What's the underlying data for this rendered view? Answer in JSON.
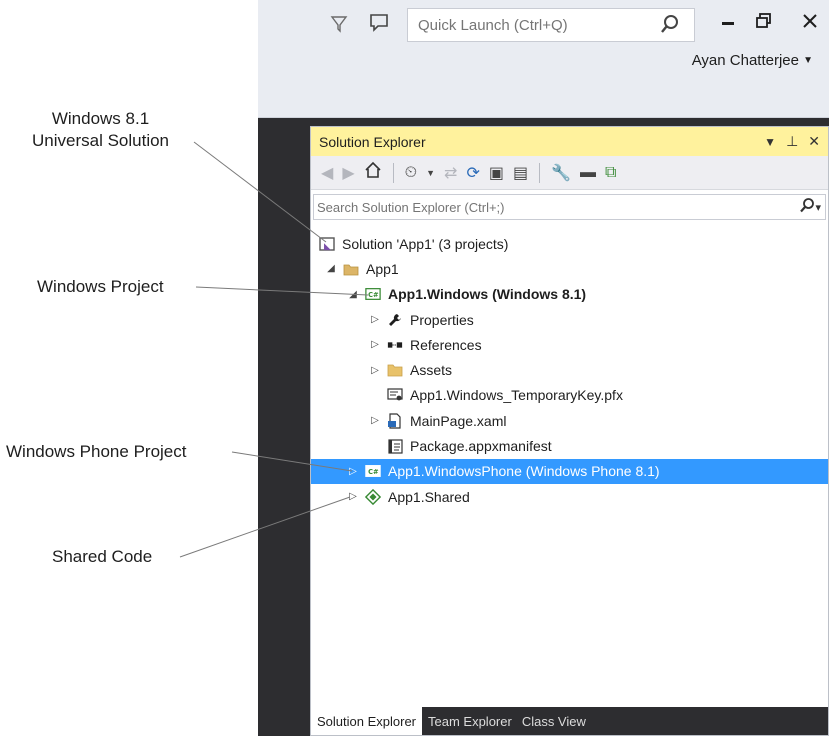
{
  "annotations": {
    "solution_line1": "Windows 8.1",
    "solution_line2": "Universal Solution",
    "windows_project": "Windows Project",
    "windows_phone_project": "Windows Phone Project",
    "shared_code": "Shared Code"
  },
  "titlebar": {
    "quick_launch_placeholder": "Quick Launch (Ctrl+Q)",
    "user_name": "Ayan Chatterjee",
    "icons": [
      "filter-icon",
      "feedback-icon",
      "search-icon",
      "minimize-icon",
      "restore-icon",
      "close-icon"
    ]
  },
  "solution_explorer": {
    "title": "Solution Explorer",
    "search_placeholder": "Search Solution Explorer (Ctrl+;)",
    "tree": {
      "solution": "Solution 'App1' (3 projects)",
      "app1": "App1",
      "app1_windows": "App1.Windows (Windows 8.1)",
      "properties": "Properties",
      "references": "References",
      "assets": "Assets",
      "temp_key": "App1.Windows_TemporaryKey.pfx",
      "mainpage": "MainPage.xaml",
      "package": "Package.appxmanifest",
      "app1_windowsphone": "App1.WindowsPhone (Windows Phone 8.1)",
      "app1_shared": "App1.Shared"
    },
    "bottom_tabs": [
      "Solution Explorer",
      "Team Explorer",
      "Class View"
    ]
  },
  "colors": {
    "title_highlight": "#fff29d",
    "selection": "#3399ff",
    "ide_dark": "#2d2d30",
    "csharp_green": "#388a34",
    "folder_yellow": "#dcb567"
  }
}
